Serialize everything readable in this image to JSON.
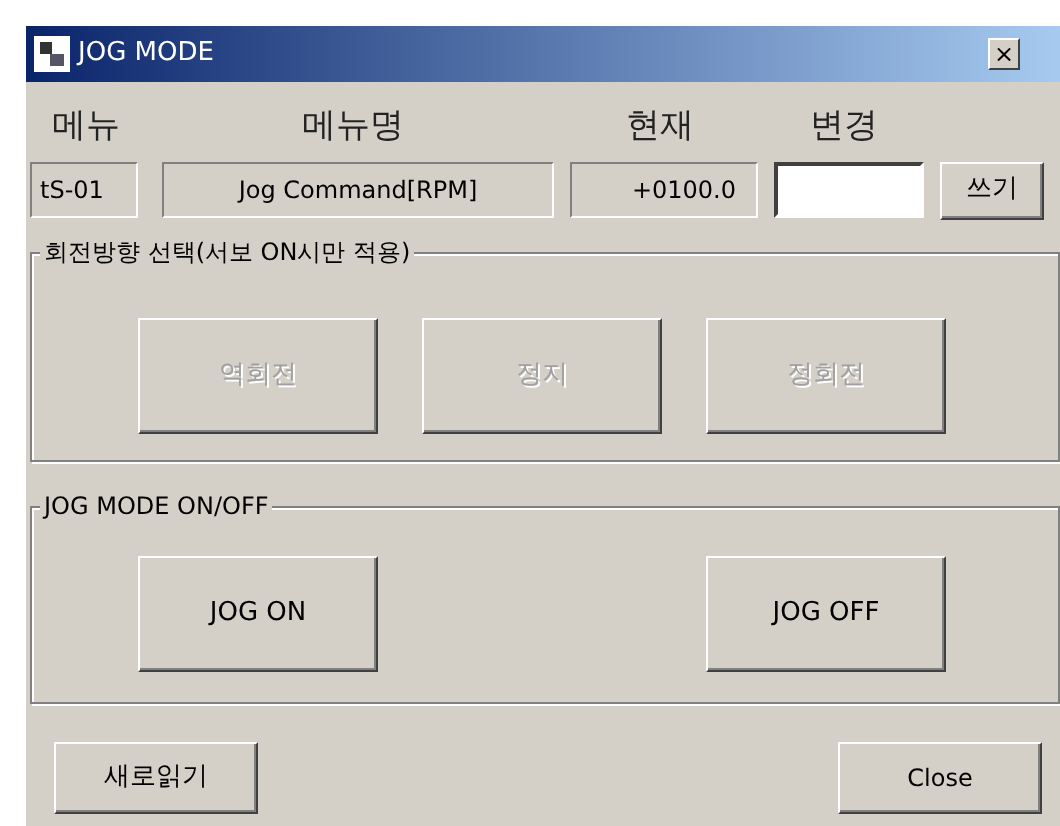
{
  "window": {
    "title": "JOG MODE",
    "close": "×"
  },
  "headers": [
    "메뉴",
    "메뉴명",
    "현재",
    "변경"
  ],
  "fields": {
    "code": "tS-01",
    "name": "Jog Command[RPM]",
    "current": "+0100.0",
    "write_button": "쓰기"
  },
  "groups": [
    {
      "title": "회전방향 선택(서보 ON시만 적용)",
      "buttons": [
        {
          "label": "역회전",
          "disabled": true
        },
        {
          "label": "정지",
          "disabled": true
        },
        {
          "label": "정회전",
          "disabled": true
        }
      ]
    },
    {
      "title": "JOG MODE ON/OFF",
      "buttons": [
        {
          "label": "JOG ON",
          "disabled": false
        },
        {
          "label": "JOG OFF",
          "disabled": false
        }
      ]
    }
  ],
  "footer": {
    "reload": "새로읽기",
    "close": "Close"
  }
}
